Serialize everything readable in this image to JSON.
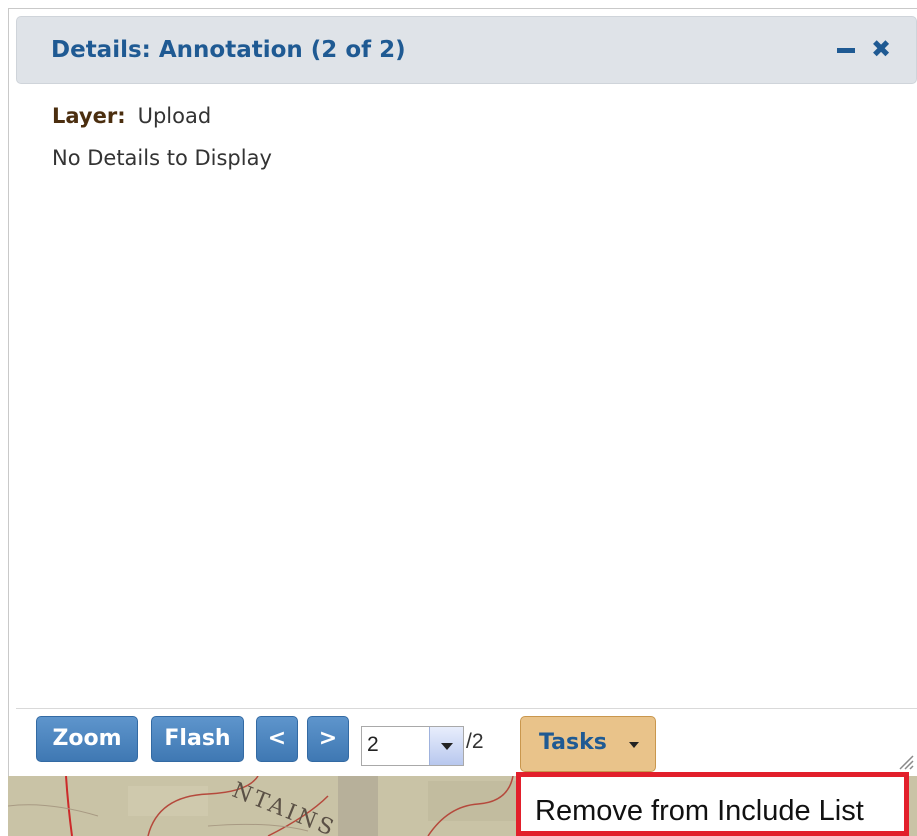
{
  "panel": {
    "title": "Details: Annotation (2 of 2)",
    "minimize_icon": "minimize-icon",
    "close_icon": "close-icon"
  },
  "details": {
    "layer_label": "Layer:",
    "layer_value": "Upload",
    "no_details": "No Details to Display"
  },
  "toolbar": {
    "zoom_label": "Zoom",
    "flash_label": "Flash",
    "prev_label": "<",
    "next_label": ">",
    "page_value": "2",
    "page_total": "/2",
    "tasks_label": "Tasks"
  },
  "map": {
    "label_fragment": "NTAINS"
  },
  "menu": {
    "items": [
      {
        "label": "Remove from Include List",
        "highlighted": true
      }
    ]
  },
  "colors": {
    "header_text": "#1f5a93",
    "button_blue": "#4a83bf",
    "tasks_orange": "#e9c38a",
    "highlight_red": "#e21f2b"
  }
}
